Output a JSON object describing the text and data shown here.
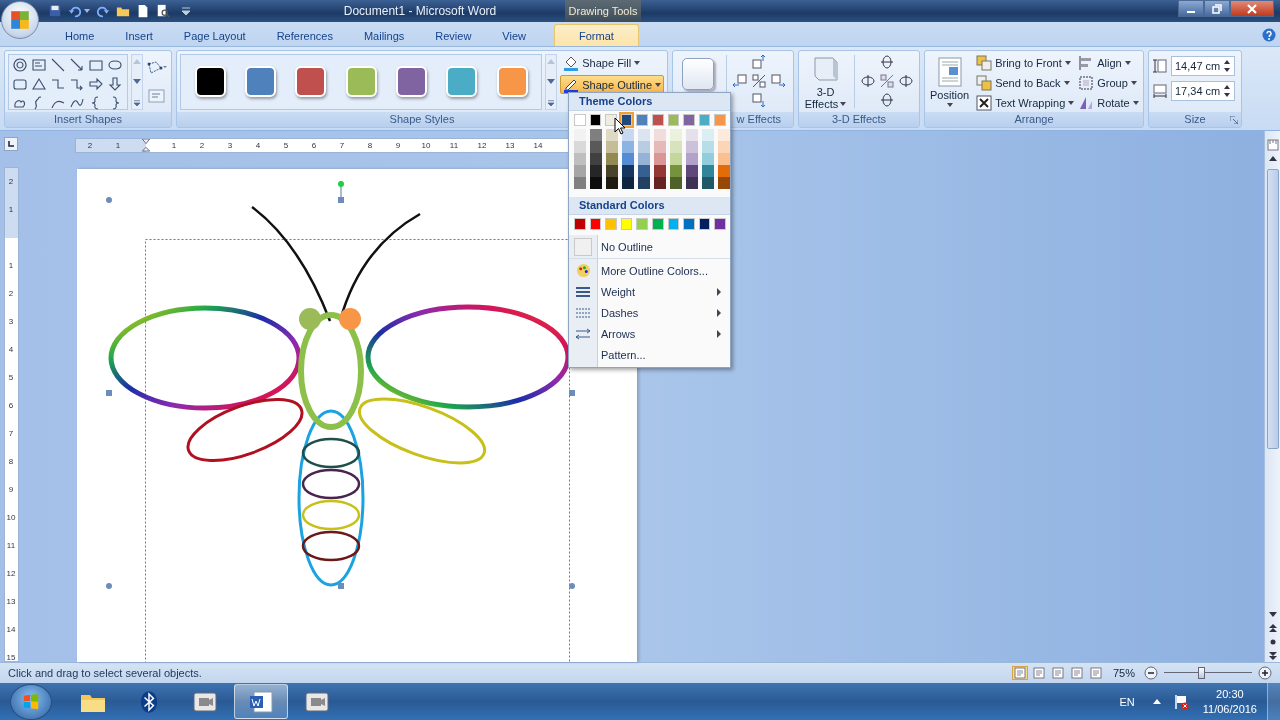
{
  "window": {
    "title": "Document1 - Microsoft Word",
    "contextual_tab": "Drawing Tools"
  },
  "tabs": [
    {
      "label": "Home",
      "selected": false
    },
    {
      "label": "Insert",
      "selected": false
    },
    {
      "label": "Page Layout",
      "selected": false
    },
    {
      "label": "References",
      "selected": false
    },
    {
      "label": "Mailings",
      "selected": false
    },
    {
      "label": "Review",
      "selected": false
    },
    {
      "label": "View",
      "selected": false
    },
    {
      "label": "Format",
      "selected": true
    }
  ],
  "ribbon": {
    "insert_shapes": {
      "label": "Insert Shapes"
    },
    "shape_styles": {
      "label": "Shape Styles",
      "swatches": [
        {
          "color": "#000000"
        },
        {
          "color": "#4f81bd"
        },
        {
          "color": "#c0504d"
        },
        {
          "color": "#9bbb59"
        },
        {
          "color": "#8064a2"
        },
        {
          "color": "#4bacc6"
        },
        {
          "color": "#f79646"
        }
      ],
      "shape_fill": "Shape Fill",
      "shape_outline": {
        "label": "Shape Outline",
        "expanded": true
      }
    },
    "shadow_effects": {
      "label": "w Effects"
    },
    "three_d_effects": {
      "button_line_1": "3-D",
      "button_line_2": "Effects",
      "label": "3-D Effects"
    },
    "arrange": {
      "label": "Arrange",
      "position": "Position",
      "commands": [
        "Bring to Front",
        "Send to Back",
        "Text Wrapping",
        "Align",
        "Group",
        "Rotate"
      ]
    },
    "size": {
      "label": "Size",
      "height": "14,47 cm",
      "width": "17,34 cm"
    }
  },
  "rulers": {
    "horizontal_before": [
      "2",
      "1"
    ],
    "horizontal_after": [
      "1",
      "2",
      "3",
      "4",
      "5",
      "6",
      "7",
      "8",
      "9",
      "10",
      "11",
      "12",
      "13",
      "14"
    ],
    "vertical_before": [
      "2",
      "1"
    ],
    "vertical_after": [
      "1",
      "2",
      "3",
      "4",
      "5",
      "6",
      "7",
      "8",
      "9",
      "10",
      "11",
      "12",
      "13",
      "14",
      "15"
    ]
  },
  "outline_menu": {
    "theme_heading": "Theme Colors",
    "theme_colors": [
      {
        "color": "#ffffff",
        "selected": false,
        "shades": [
          {
            "color": "#f2f2f2"
          },
          {
            "color": "#d9d9d9"
          },
          {
            "color": "#bfbfbf"
          },
          {
            "color": "#a6a6a6"
          },
          {
            "color": "#808080"
          }
        ]
      },
      {
        "color": "#000000",
        "selected": false,
        "shades": [
          {
            "color": "#7f7f7f"
          },
          {
            "color": "#595959"
          },
          {
            "color": "#404040"
          },
          {
            "color": "#262626"
          },
          {
            "color": "#0d0d0d"
          }
        ]
      },
      {
        "color": "#eeece1",
        "selected": false,
        "shades": [
          {
            "color": "#ddd9c3"
          },
          {
            "color": "#c4bd97"
          },
          {
            "color": "#938953"
          },
          {
            "color": "#494429"
          },
          {
            "color": "#1d1b10"
          }
        ]
      },
      {
        "color": "#1f497d",
        "selected": true,
        "shades": [
          {
            "color": "#c6d9f0"
          },
          {
            "color": "#8db3e2"
          },
          {
            "color": "#548dd4"
          },
          {
            "color": "#17365d"
          },
          {
            "color": "#0f243e"
          }
        ]
      },
      {
        "color": "#4f81bd",
        "selected": false,
        "shades": [
          {
            "color": "#dbe5f1"
          },
          {
            "color": "#b8cce4"
          },
          {
            "color": "#95b3d7"
          },
          {
            "color": "#366092"
          },
          {
            "color": "#244061"
          }
        ]
      },
      {
        "color": "#c0504d",
        "selected": false,
        "shades": [
          {
            "color": "#f2dcdb"
          },
          {
            "color": "#e5b9b7"
          },
          {
            "color": "#d99694"
          },
          {
            "color": "#953734"
          },
          {
            "color": "#632423"
          }
        ]
      },
      {
        "color": "#9bbb59",
        "selected": false,
        "shades": [
          {
            "color": "#ebf1dd"
          },
          {
            "color": "#d7e3bc"
          },
          {
            "color": "#c3d69b"
          },
          {
            "color": "#76923c"
          },
          {
            "color": "#4f6128"
          }
        ]
      },
      {
        "color": "#8064a2",
        "selected": false,
        "shades": [
          {
            "color": "#e5e0ec"
          },
          {
            "color": "#ccc1d9"
          },
          {
            "color": "#b2a2c7"
          },
          {
            "color": "#5f497a"
          },
          {
            "color": "#3f3151"
          }
        ]
      },
      {
        "color": "#4bacc6",
        "selected": false,
        "shades": [
          {
            "color": "#dbeef3"
          },
          {
            "color": "#b7dde8"
          },
          {
            "color": "#92cddc"
          },
          {
            "color": "#31859b"
          },
          {
            "color": "#205867"
          }
        ]
      },
      {
        "color": "#f79646",
        "selected": false,
        "shades": [
          {
            "color": "#fdeada"
          },
          {
            "color": "#fbd5b5"
          },
          {
            "color": "#fac08f"
          },
          {
            "color": "#e36c09"
          },
          {
            "color": "#974806"
          }
        ]
      }
    ],
    "standard_heading": "Standard Colors",
    "standard_colors": [
      {
        "color": "#c00000"
      },
      {
        "color": "#ff0000"
      },
      {
        "color": "#ffc000"
      },
      {
        "color": "#ffff00"
      },
      {
        "color": "#92d050"
      },
      {
        "color": "#00b050"
      },
      {
        "color": "#00b0f0"
      },
      {
        "color": "#0070c0"
      },
      {
        "color": "#002060"
      },
      {
        "color": "#7030a0"
      }
    ],
    "items": [
      {
        "label": "No Outline",
        "kind": "none",
        "submenu": false
      },
      {
        "label": "More Outline Colors...",
        "kind": "palette",
        "submenu": false
      },
      {
        "label": "Weight",
        "kind": "weight",
        "submenu": true
      },
      {
        "label": "Dashes",
        "kind": "dashes",
        "submenu": true
      },
      {
        "label": "Arrows",
        "kind": "arrows",
        "submenu": true
      },
      {
        "label": "Pattern...",
        "kind": "plain",
        "submenu": false
      }
    ]
  },
  "status_bar": {
    "text": "Click and drag to select several objects.",
    "zoom": "75%",
    "zoom_slider": {
      "level": 0.42
    }
  },
  "taskbar": {
    "apps": [
      {
        "kind": "folder",
        "selected": false
      },
      {
        "kind": "bluetooth",
        "selected": false
      },
      {
        "kind": "window",
        "selected": false
      },
      {
        "kind": "word",
        "selected": true
      },
      {
        "kind": "window",
        "selected": false
      }
    ],
    "language": "EN",
    "time": "20:30",
    "date": "11/06/2016"
  }
}
